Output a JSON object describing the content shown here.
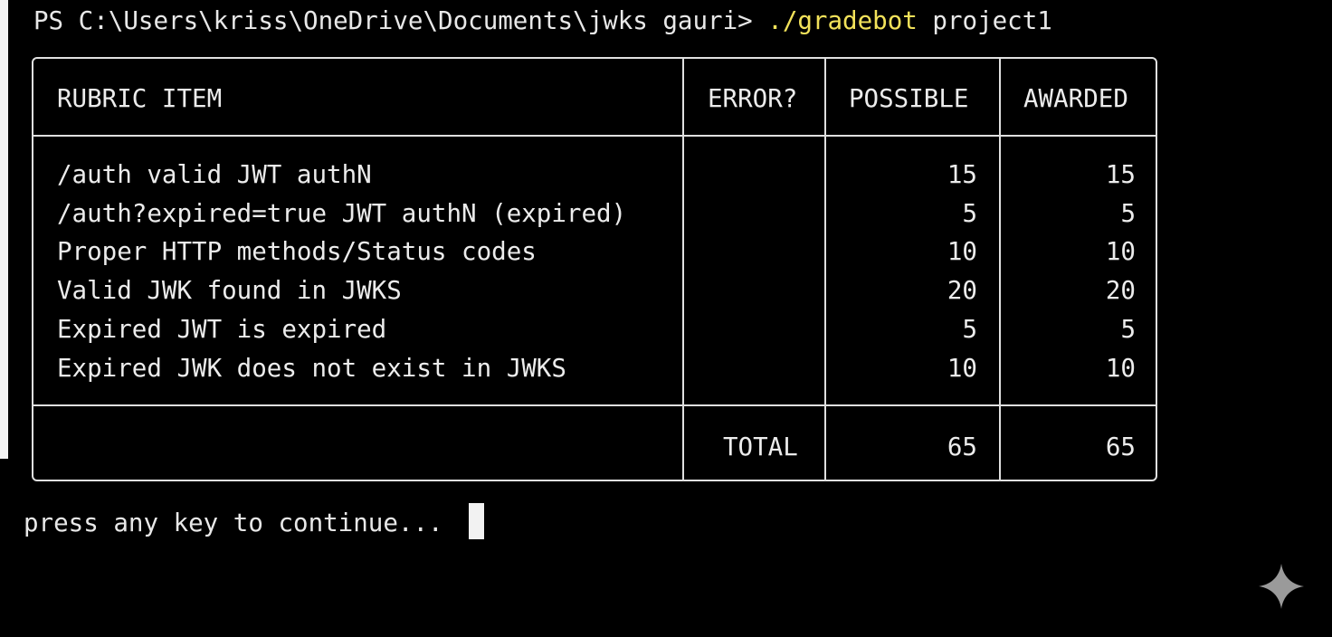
{
  "prompt": {
    "path": "PS C:\\Users\\kriss\\OneDrive\\Documents\\jwks gauri> ",
    "command": "./gradebot",
    "argument": " project1"
  },
  "table": {
    "headers": {
      "rubric_item": "RUBRIC ITEM",
      "error": "ERROR?",
      "possible": "POSSIBLE",
      "awarded": "AWARDED"
    },
    "rows": [
      {
        "item": "/auth valid JWT authN",
        "error": "",
        "possible": "15",
        "awarded": "15"
      },
      {
        "item": "/auth?expired=true JWT authN (expired)",
        "error": "",
        "possible": "5",
        "awarded": "5"
      },
      {
        "item": "Proper HTTP methods/Status codes",
        "error": "",
        "possible": "10",
        "awarded": "10"
      },
      {
        "item": "Valid JWK found in JWKS",
        "error": "",
        "possible": "20",
        "awarded": "20"
      },
      {
        "item": "Expired JWT is expired",
        "error": "",
        "possible": "5",
        "awarded": "5"
      },
      {
        "item": "Expired JWK does not exist in JWKS",
        "error": "",
        "possible": "10",
        "awarded": "10"
      }
    ],
    "footer": {
      "total_label": "TOTAL",
      "possible_total": "65",
      "awarded_total": "65"
    }
  },
  "status": {
    "continue_text": "press any key to continue..."
  },
  "icons": {
    "sparkle": "sparkle-icon"
  },
  "colors": {
    "background": "#000000",
    "text": "#e8e8e8",
    "command_highlight": "#f2e25a"
  }
}
